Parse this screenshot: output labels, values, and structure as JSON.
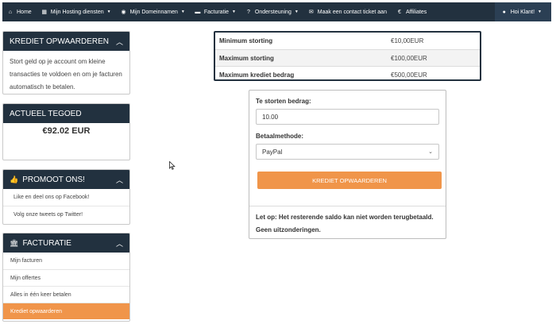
{
  "navbar": {
    "items": [
      {
        "label": "Home",
        "icon": "home-icon",
        "glyph": "⌂",
        "caret": false
      },
      {
        "label": "Mijn Hosting diensten",
        "icon": "cubes-icon",
        "glyph": "▦",
        "caret": true
      },
      {
        "label": "Mijn Domeinnamen",
        "icon": "globe-icon",
        "glyph": "◉",
        "caret": true
      },
      {
        "label": "Facturatie",
        "icon": "credit-card-icon",
        "glyph": "▬",
        "caret": true
      },
      {
        "label": "Ondersteuning",
        "icon": "question-icon",
        "glyph": "?",
        "caret": true
      },
      {
        "label": "Maak een contact ticket aan",
        "icon": "envelope-icon",
        "glyph": "✉",
        "caret": false
      },
      {
        "label": "Affiliates",
        "icon": "euro-icon",
        "glyph": "€",
        "caret": false
      }
    ],
    "user": {
      "label": "Hoi Klant!",
      "icon": "user-icon",
      "glyph": "👤"
    }
  },
  "sidebar": {
    "krediet": {
      "title": "KREDIET OPWAARDEREN",
      "text": "Stort geld op je account om kleine transacties te voldoen en om je facturen automatisch te betalen."
    },
    "tegoed": {
      "title": "ACTUEEL TEGOED",
      "balance": "€92.02 EUR"
    },
    "promoot": {
      "title": "PROMOOT ONS!",
      "items": [
        "Like en deel ons op Facebook!",
        "Volg onze tweets op Twitter!"
      ]
    },
    "facturatie": {
      "title": "FACTURATIE",
      "items": [
        "Mijn facturen",
        "Mijn offertes",
        "Alles in één keer betalen",
        "Krediet opwaarderen"
      ]
    }
  },
  "limits": {
    "rows": [
      {
        "label": "Minimum storting",
        "value": "€10,00EUR"
      },
      {
        "label": "Maximum storting",
        "value": "€100,00EUR"
      },
      {
        "label": "Maximum krediet bedrag",
        "value": "€500,00EUR"
      }
    ]
  },
  "form": {
    "amount_label": "Te storten bedrag:",
    "amount_value": "10.00",
    "method_label": "Betaalmethode:",
    "method_value": "PayPal",
    "submit_label": "KREDIET OPWAARDEREN",
    "note": "Let op: Het resterende saldo kan niet worden terugbetaald. Geen uitzonderingen."
  },
  "colors": {
    "navbar": "#22313f",
    "accent": "#f0954a"
  }
}
